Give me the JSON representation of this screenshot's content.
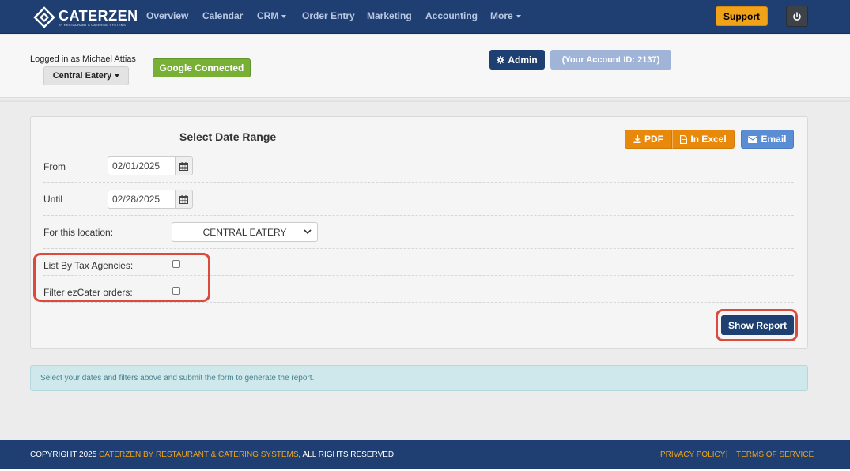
{
  "brand": {
    "name": "CATERZEN",
    "tagline": "BY RESTAURANT & CATERING SYSTEMS"
  },
  "nav": {
    "items": [
      "Overview",
      "Calendar",
      "CRM",
      "Order Entry",
      "Marketing",
      "Accounting",
      "More"
    ],
    "support_label": "Support"
  },
  "account": {
    "logged_in": "Logged in as Michael Attias",
    "location": "Central Eatery",
    "google": "Google Connected",
    "admin": "Admin",
    "account_id": "(Your Account ID: 2137)"
  },
  "panel": {
    "title": "Select Date Range",
    "pdf_label": "PDF",
    "excel_label": "In Excel",
    "email_label": "Email",
    "from_label": "From",
    "from_value": "02/01/2025",
    "until_label": "Until",
    "until_value": "02/28/2025",
    "location_label": "For this location:",
    "location_value": "CENTRAL EATERY",
    "tax_label": "List By Tax Agencies:",
    "ezcater_label": "Filter ezCater orders:",
    "show_report": "Show Report"
  },
  "info": "Select your dates and filters above and submit the form to generate the report.",
  "footer": {
    "copyright_prefix": "COPYRIGHT 2025 ",
    "copyright_link": "CATERZEN BY RESTAURANT & CATERING SYSTEMS",
    "copyright_suffix": ", ALL RIGHTS RESERVED.",
    "privacy": "PRIVACY POLICY",
    "separator": "|",
    "terms": "TERMS OF SERVICE"
  },
  "colors": {
    "nav_bg": "#1f3f73",
    "accent_orange": "#e8890c",
    "support_orange": "#f0a318",
    "google_green": "#77b035",
    "email_blue": "#5b8dd4",
    "highlight_red": "#dc4a3d"
  }
}
